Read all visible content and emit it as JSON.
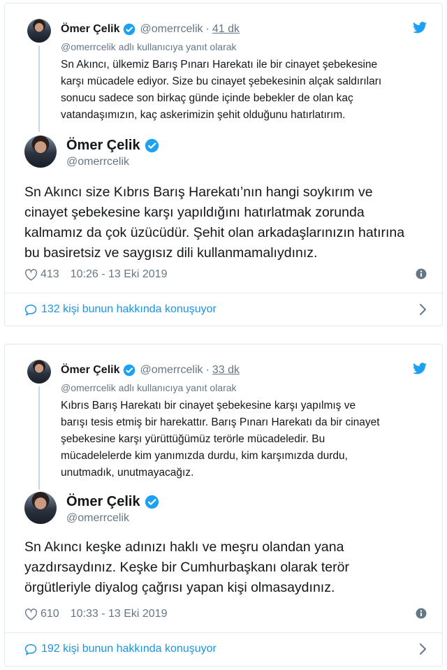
{
  "tweets": [
    {
      "quoted": {
        "name": "Ömer Çelik",
        "handle": "@omerrcelik",
        "separator": "·",
        "time": "41 dk",
        "reply_to": "@omerrcelik adlı kullanıcıya yanıt olarak",
        "lines": [
          "Sn Akıncı, ülkemiz Barış Pınarı Harekatı ile bir cinayet şebekesine",
          "karşı mücadele ediyor. Size bu cinayet şebekesinin alçak saldırıları",
          "sonucu sadece son birkaç günde içinde bebekler de olan kaç",
          "vatandaşımızın, kaç askerimizin şehit olduğunu hatırlatırım."
        ]
      },
      "author": {
        "name": "Ömer Çelik",
        "handle": "@omerrcelik"
      },
      "lines": [
        "Sn Akıncı size Kıbrıs Barış Harekatı’nın hangi soykırım ve",
        "cinayet şebekesine karşı yapıldığını hatırlatmak zorunda",
        "kalmamız da çok üzücüdür. Şehit olan arkadaşlarınızın hatırına",
        "bu basiretsiz ve saygısız dili kullanmamalıydınız."
      ],
      "likes": "413",
      "timestamp": "10:26 - 13 Eki 2019",
      "conversation": "132 kişi bunun hakkında konuşuyor"
    },
    {
      "quoted": {
        "name": "Ömer Çelik",
        "handle": "@omerrcelik",
        "separator": "·",
        "time": "33 dk",
        "reply_to": "@omerrcelik adlı kullanıcıya yanıt olarak",
        "lines": [
          "Kıbrıs Barış Harekatı bir cinayet şebekesine karşı yapılmış ve",
          "barışı tesis etmiş bir harekattır. Barış Pınarı Harekatı da bir cinayet",
          "şebekesine karşı yürüttüğümüz terörle mücadeledir. Bu",
          "mücadelelerde kim yanımızda durdu, kim karşımızda durdu,",
          "unutmadık, unutmayacağız."
        ]
      },
      "author": {
        "name": "Ömer Çelik",
        "handle": "@omerrcelik"
      },
      "lines": [
        "Sn Akıncı keşke adınızı haklı ve meşru olandan yana",
        "yazdırsaydınız. Keşke bir Cumhurbaşkanı olarak terör",
        "örgütleriyle diyalog çağrısı yapan kişi olmasaydınız."
      ],
      "likes": "610",
      "timestamp": "10:33 - 13 Eki 2019",
      "conversation": "192 kişi bunun hakkında konuşuyor"
    }
  ],
  "colors": {
    "accent": "#1da1f2",
    "link": "#1b95e0",
    "muted": "#657786",
    "text": "#14171a",
    "border": "#e1e8ed"
  },
  "icons": {
    "verified": "verified-badge-icon",
    "twitter": "twitter-bird-icon",
    "like": "heart-icon",
    "info": "info-icon",
    "reply": "speech-bubble-icon",
    "expand": "chevron-right-icon"
  }
}
